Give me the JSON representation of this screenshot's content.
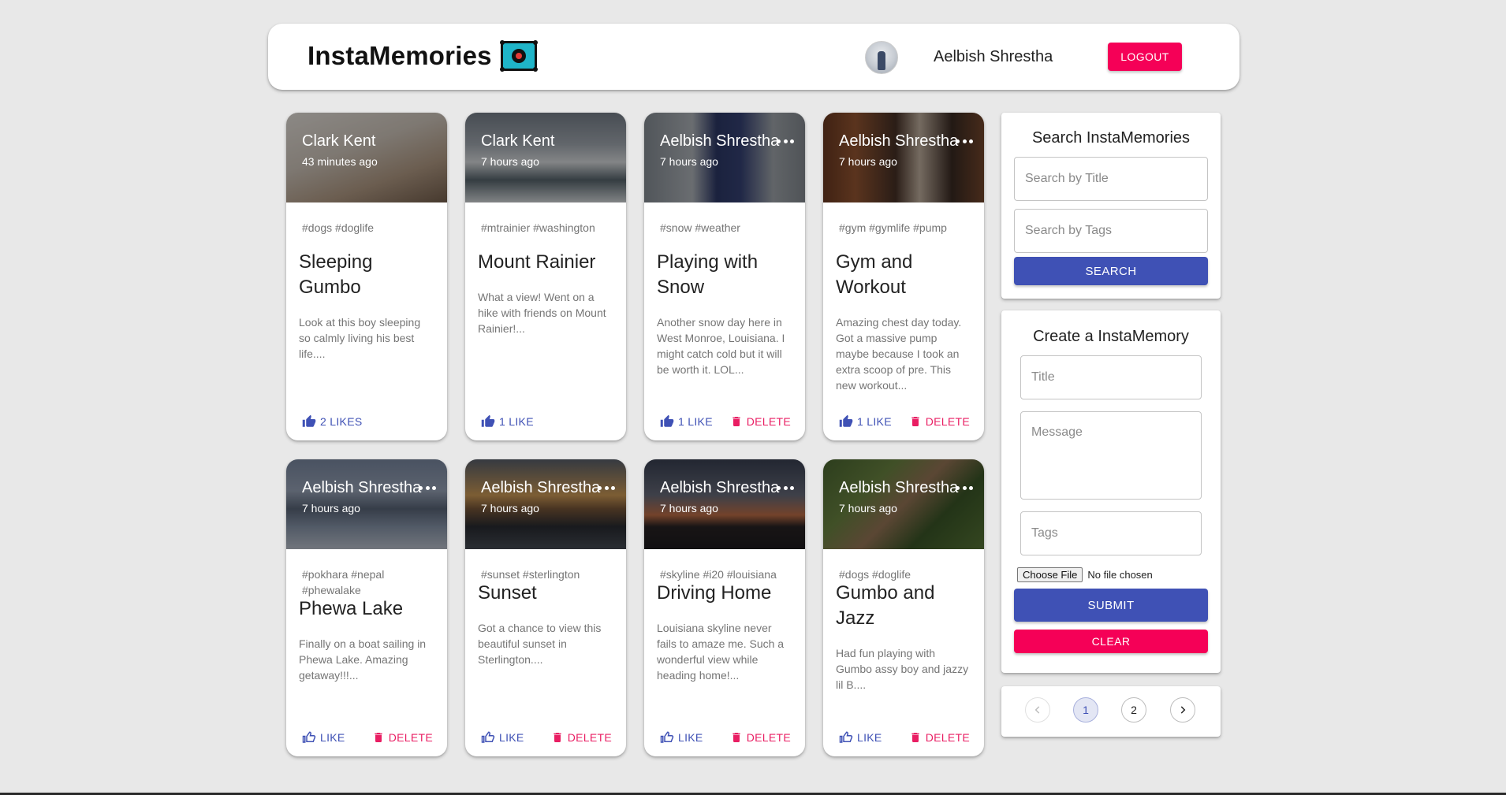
{
  "header": {
    "brand": "InstaMemories",
    "user_name": "Aelbish Shrestha",
    "logout_label": "LOGOUT"
  },
  "posts": [
    {
      "author": "Clark Kent",
      "time": "43 minutes ago",
      "tags": "#dogs #doglife",
      "title": "Sleeping Gumbo",
      "message": "Look at this boy sleeping so calmly living his best life....",
      "like_label": "2 LIKES",
      "delete_label": "",
      "liked": true
    },
    {
      "author": "Clark Kent",
      "time": "7 hours ago",
      "tags": "#mtrainier #washington",
      "title": "Mount Rainier",
      "message": "What a view! Went on a hike with friends on Mount Rainier!...",
      "like_label": "1 LIKE",
      "delete_label": "",
      "liked": true
    },
    {
      "author": "Aelbish Shrestha",
      "time": "7 hours ago",
      "tags": "#snow #weather",
      "title": "Playing with Snow",
      "message": "Another snow day here in West Monroe, Louisiana. I might catch cold but it will be worth it. LOL...",
      "like_label": "1 LIKE",
      "delete_label": "DELETE",
      "liked": true
    },
    {
      "author": "Aelbish Shrestha",
      "time": "7 hours ago",
      "tags": "#gym #gymlife #pump",
      "title": "Gym and Workout",
      "message": "Amazing chest day today. Got a massive pump maybe because I took an extra scoop of pre. This new workout...",
      "like_label": "1 LIKE",
      "delete_label": "DELETE",
      "liked": true
    },
    {
      "author": "Aelbish Shrestha",
      "time": "7 hours ago",
      "tags": "#pokhara #nepal #phewalake",
      "title": "Phewa Lake",
      "message": "Finally on a boat sailing in Phewa Lake. Amazing getaway!!!...",
      "like_label": "LIKE",
      "delete_label": "DELETE",
      "liked": false
    },
    {
      "author": "Aelbish Shrestha",
      "time": "7 hours ago",
      "tags": "#sunset #sterlington",
      "title": "Sunset",
      "message": "Got a chance to view this beautiful sunset in Sterlington....",
      "like_label": "LIKE",
      "delete_label": "DELETE",
      "liked": false
    },
    {
      "author": "Aelbish Shrestha",
      "time": "7 hours ago",
      "tags": "#skyline #i20 #louisiana",
      "title": "Driving Home",
      "message": "Louisiana skyline never fails to amaze me. Such a wonderful view while heading home!...",
      "like_label": "LIKE",
      "delete_label": "DELETE",
      "liked": false
    },
    {
      "author": "Aelbish Shrestha",
      "time": "7 hours ago",
      "tags": "#dogs #doglife",
      "title": "Gumbo and Jazz",
      "message": "Had fun playing with Gumbo assy boy and jazzy lil B....",
      "like_label": "LIKE",
      "delete_label": "DELETE",
      "liked": false
    }
  ],
  "search": {
    "title": "Search InstaMemories",
    "title_placeholder": "Search by Title",
    "tags_placeholder": "Search by Tags",
    "button_label": "SEARCH"
  },
  "create": {
    "title": "Create a InstaMemory",
    "title_placeholder": "Title",
    "message_placeholder": "Message",
    "tags_placeholder": "Tags",
    "file_button_label": "Choose File",
    "file_status": "No file chosen",
    "submit_label": "SUBMIT",
    "clear_label": "CLEAR"
  },
  "pagination": {
    "pages": [
      "1",
      "2"
    ],
    "current": "1"
  },
  "colors": {
    "primary": "#3f51b5",
    "secondary": "#f50057",
    "delete": "#e91e63"
  }
}
